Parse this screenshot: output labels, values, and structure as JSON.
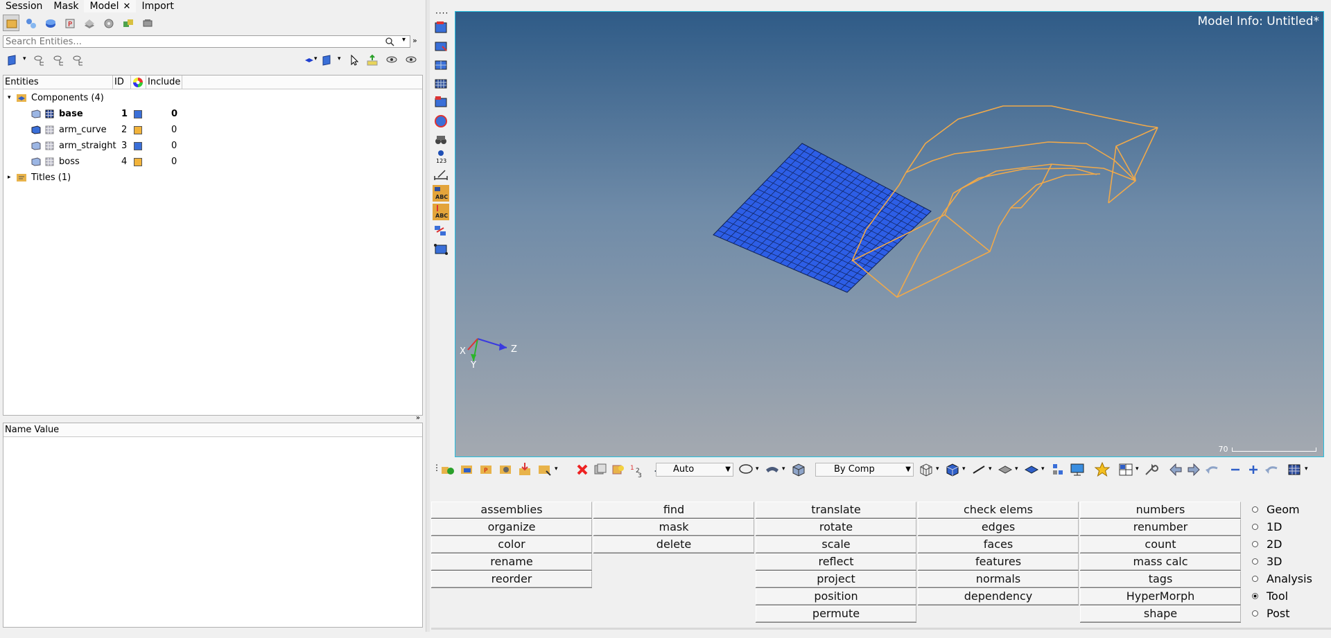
{
  "tabs": [
    {
      "label": "Session"
    },
    {
      "label": "Mask"
    },
    {
      "label": "Model",
      "closable": true
    },
    {
      "label": "Import"
    }
  ],
  "search": {
    "placeholder": "Search Entities..."
  },
  "entities_header": {
    "entities": "Entities",
    "id": "ID",
    "include": "Include"
  },
  "tree": {
    "components_label": "Components (4)",
    "titles_label": "Titles (1)",
    "components": [
      {
        "name": "base",
        "id": "1",
        "color": "#3a6fd8",
        "include": "0",
        "bold": true
      },
      {
        "name": "arm_curve",
        "id": "2",
        "color": "#f2b33a",
        "include": "0"
      },
      {
        "name": "arm_straight",
        "id": "3",
        "color": "#3a6fd8",
        "include": "0"
      },
      {
        "name": "boss",
        "id": "4",
        "color": "#f2b33a",
        "include": "0"
      }
    ]
  },
  "props": {
    "header": "Name Value"
  },
  "viewport": {
    "model_info": "Model Info: Untitled*",
    "scale_label": "70",
    "axis_x": "X",
    "axis_y": "Y",
    "axis_z": "Z"
  },
  "toolbar": {
    "auto_label": "Auto",
    "bycomp_label": "By Comp"
  },
  "menu": {
    "col1": [
      "assemblies",
      "organize",
      "color",
      "rename",
      "reorder"
    ],
    "col2": [
      "find",
      "mask",
      "delete"
    ],
    "col3": [
      "translate",
      "rotate",
      "scale",
      "reflect",
      "project",
      "position",
      "permute"
    ],
    "col4": [
      "check elems",
      "edges",
      "faces",
      "features",
      "normals",
      "dependency"
    ],
    "col5": [
      "numbers",
      "renumber",
      "count",
      "mass calc",
      "tags",
      "HyperMorph",
      "shape"
    ],
    "radios": [
      {
        "label": "Geom",
        "selected": false
      },
      {
        "label": "1D",
        "selected": false
      },
      {
        "label": "2D",
        "selected": false
      },
      {
        "label": "3D",
        "selected": false
      },
      {
        "label": "Analysis",
        "selected": false
      },
      {
        "label": "Tool",
        "selected": true
      },
      {
        "label": "Post",
        "selected": false
      }
    ]
  },
  "colors": {
    "accent_blue": "#3a6fd8",
    "accent_orange": "#f2b33a",
    "mesh_blue": "#2d5ee6",
    "wire_orange": "#f0a94a"
  }
}
